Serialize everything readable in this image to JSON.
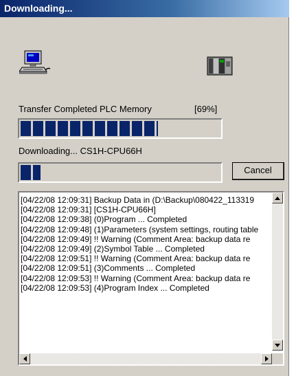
{
  "window": {
    "title": "Downloading..."
  },
  "icons": {
    "source": "computer-icon",
    "target": "plc-icon"
  },
  "transfer": {
    "label": "Transfer Completed PLC Memory",
    "percent_text": "[69%]",
    "progress": 0.69
  },
  "download": {
    "label": "Downloading... CS1H-CPU66H",
    "progress": 0.1
  },
  "buttons": {
    "cancel": "Cancel"
  },
  "log": {
    "lines": [
      "[04/22/08 12:09:31] Backup Data in (D:\\Backup\\080422_113319",
      "[04/22/08 12:09:31] [CS1H-CPU66H]",
      "[04/22/08 12:09:38]  (0)Program  ... Completed",
      "[04/22/08 12:09:48]  (1)Parameters (system settings, routing table",
      "[04/22/08 12:09:49]    !! Warning (Comment Area: backup data re",
      "[04/22/08 12:09:49]  (2)Symbol Table  ... Completed",
      "[04/22/08 12:09:51]    !! Warning (Comment Area: backup data re",
      "[04/22/08 12:09:51]  (3)Comments  ... Completed",
      "[04/22/08 12:09:53]    !! Warning (Comment Area: backup data re",
      "[04/22/08 12:09:53]  (4)Program Index  ... Completed"
    ]
  }
}
